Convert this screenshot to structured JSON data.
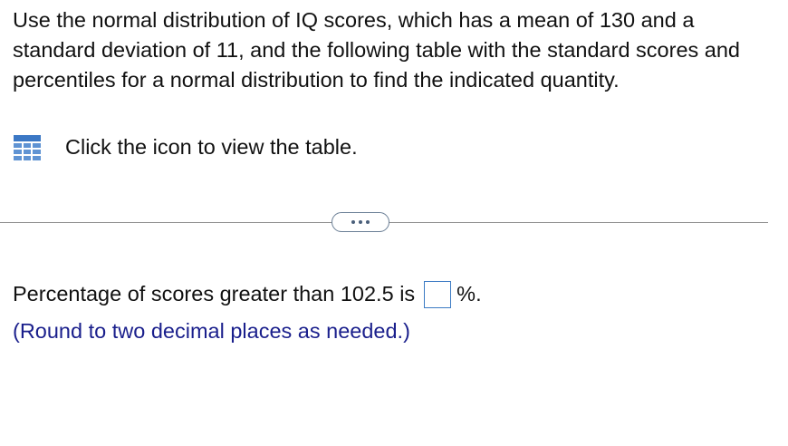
{
  "question": {
    "text": "Use the normal distribution of IQ scores, which has a mean of 130 and a standard deviation of 11, and the following table with the standard scores and percentiles for a normal distribution to find the indicated quantity."
  },
  "table_link": {
    "icon": "table-grid-icon",
    "label": "Click the icon to view the table."
  },
  "divider": {
    "button_icon": "more-dots-icon"
  },
  "answer": {
    "prefix": "Percentage of scores greater than 102.5 is",
    "value": "",
    "suffix": "%."
  },
  "hint": "(Round to two decimal places as needed.)",
  "colors": {
    "icon_blue": "#3b78c5",
    "input_border": "#3c7bc4",
    "hint_text": "#1a1f8c",
    "divider": "#8f8f8f"
  }
}
